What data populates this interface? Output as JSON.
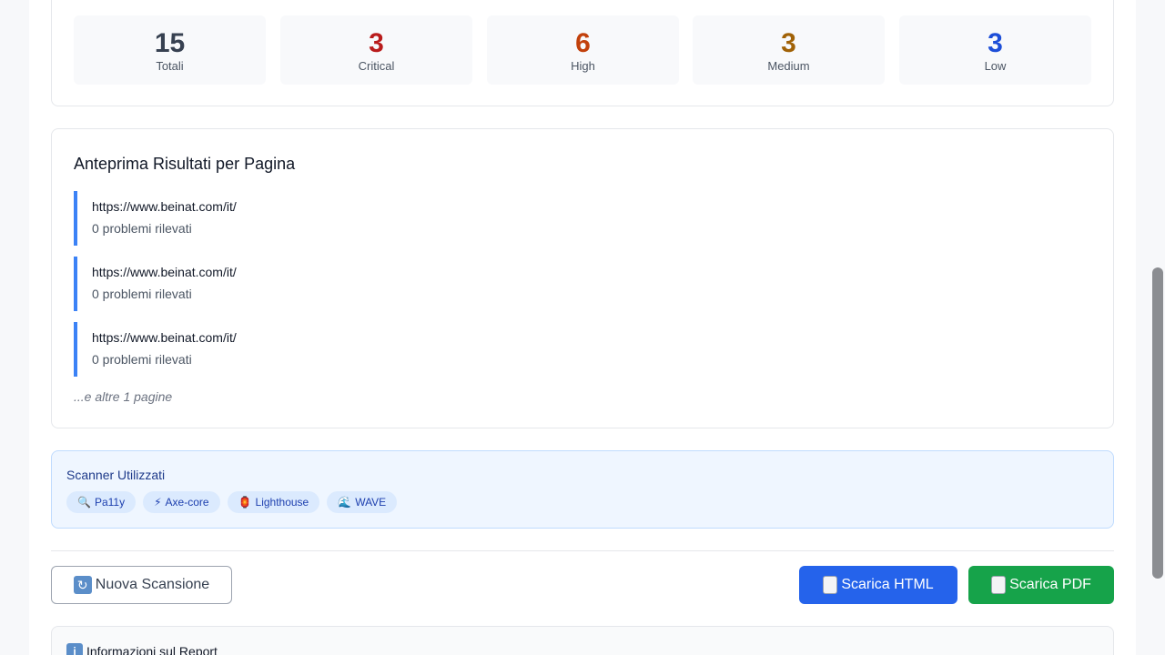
{
  "stats": [
    {
      "value": "15",
      "label": "Totali",
      "color": "#374151"
    },
    {
      "value": "3",
      "label": "Critical",
      "color": "#b91c1c"
    },
    {
      "value": "6",
      "label": "High",
      "color": "#c2410c"
    },
    {
      "value": "3",
      "label": "Medium",
      "color": "#a16207"
    },
    {
      "value": "3",
      "label": "Low",
      "color": "#1d4ed8"
    }
  ],
  "preview": {
    "title": "Anteprima Risultati per Pagina",
    "pages": [
      {
        "url": "https://www.beinat.com/it/",
        "issues": "0 problemi rilevati"
      },
      {
        "url": "https://www.beinat.com/it/",
        "issues": "0 problemi rilevati"
      },
      {
        "url": "https://www.beinat.com/it/",
        "issues": "0 problemi rilevati"
      }
    ],
    "more": "...e altre 1 pagine"
  },
  "scanners": {
    "title": "Scanner Utilizzati",
    "items": [
      {
        "icon": "🔍",
        "icon_name": "magnifier-icon",
        "label": "Pa11y"
      },
      {
        "icon": "⚡",
        "icon_name": "lightning-icon",
        "label": "Axe-core"
      },
      {
        "icon": "🏮",
        "icon_name": "lighthouse-icon",
        "label": "Lighthouse"
      },
      {
        "icon": "🌊",
        "icon_name": "wave-icon",
        "label": "WAVE"
      }
    ]
  },
  "actions": {
    "new_scan": "Nuova Scansione",
    "download_html": "Scarica HTML",
    "download_pdf": "Scarica PDF"
  },
  "info": {
    "title": "Informazioni sul Report"
  },
  "colors": {
    "accent": "#3b82f6",
    "html_button": "#2563eb",
    "pdf_button": "#16a34a"
  }
}
